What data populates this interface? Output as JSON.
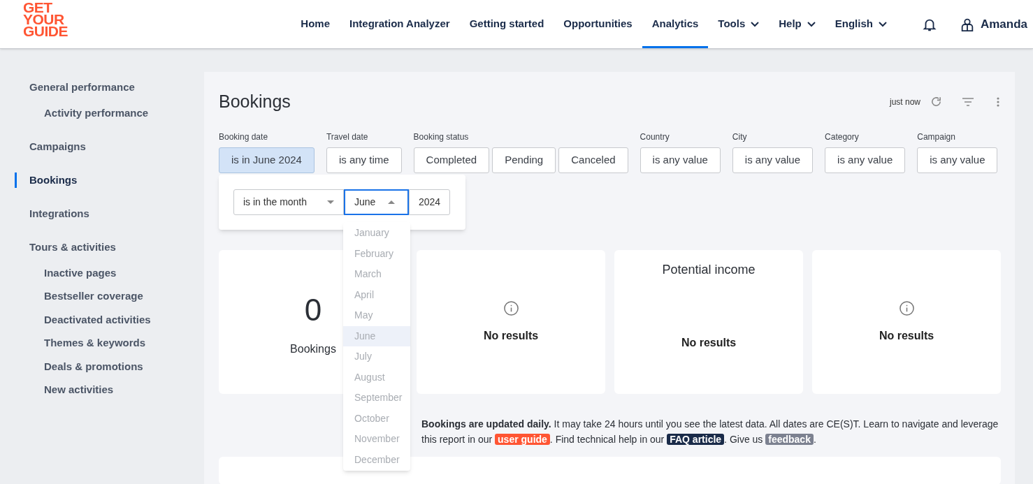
{
  "logo": [
    "GET",
    "YOUR",
    "GUIDE"
  ],
  "nav": [
    {
      "label": "Home",
      "selected": false,
      "dropdown": false
    },
    {
      "label": "Integration Analyzer",
      "selected": false,
      "dropdown": false
    },
    {
      "label": "Getting started",
      "selected": false,
      "dropdown": false
    },
    {
      "label": "Opportunities",
      "selected": false,
      "dropdown": false
    },
    {
      "label": "Analytics",
      "selected": true,
      "dropdown": false
    },
    {
      "label": "Tools",
      "selected": false,
      "dropdown": true
    },
    {
      "label": "Help",
      "selected": false,
      "dropdown": true
    },
    {
      "label": "English",
      "selected": false,
      "dropdown": true
    }
  ],
  "user": {
    "name": "Amanda"
  },
  "sidebar": {
    "items": [
      {
        "label": "General performance",
        "selected": false,
        "children": [
          {
            "label": "Activity performance",
            "selected": false
          }
        ]
      },
      {
        "label": "Campaigns",
        "selected": false
      },
      {
        "label": "Bookings",
        "selected": true
      },
      {
        "label": "Integrations",
        "selected": false
      },
      {
        "label": "Tours & activities",
        "selected": false,
        "children": [
          {
            "label": "Inactive pages",
            "selected": false
          },
          {
            "label": "Bestseller coverage",
            "selected": false
          },
          {
            "label": "Deactivated activities",
            "selected": false
          },
          {
            "label": "Themes & keywords",
            "selected": false
          },
          {
            "label": "Deals & promotions",
            "selected": false
          },
          {
            "label": "New activities",
            "selected": false
          }
        ]
      }
    ]
  },
  "report": {
    "title": "Bookings",
    "updated": "just now",
    "filters": [
      {
        "label": "Booking date",
        "kind": "single",
        "value": "is in June 2024",
        "selected": true
      },
      {
        "label": "Travel date",
        "kind": "single",
        "value": "is any time",
        "selected": false
      },
      {
        "label": "Booking status",
        "kind": "multi",
        "options": [
          "Completed",
          "Pending",
          "Canceled"
        ]
      },
      {
        "label": "Country",
        "kind": "single",
        "value": "is any value",
        "selected": false
      },
      {
        "label": "City",
        "kind": "single",
        "value": "is any value",
        "selected": false
      },
      {
        "label": "Category",
        "kind": "single",
        "value": "is any value",
        "selected": false
      },
      {
        "label": "Campaign",
        "kind": "single",
        "value": "is any value",
        "selected": false
      }
    ],
    "date_popup": {
      "operator": "is in the month",
      "month": "June",
      "year": "2024",
      "months": [
        {
          "label": "January",
          "selected": false
        },
        {
          "label": "February",
          "selected": false
        },
        {
          "label": "March",
          "selected": false
        },
        {
          "label": "April",
          "selected": false
        },
        {
          "label": "May",
          "selected": false
        },
        {
          "label": "June",
          "selected": true
        },
        {
          "label": "July",
          "selected": false
        },
        {
          "label": "August",
          "selected": false
        },
        {
          "label": "September",
          "selected": false
        },
        {
          "label": "October",
          "selected": false
        },
        {
          "label": "November",
          "selected": false
        },
        {
          "label": "December",
          "selected": false
        }
      ]
    },
    "cards": [
      {
        "kind": "metric",
        "value": "0",
        "label": "Bookings"
      },
      {
        "kind": "empty",
        "info_icon": true,
        "message": "No results"
      },
      {
        "kind": "empty",
        "title": "Potential income",
        "message": "No results"
      },
      {
        "kind": "empty",
        "info_icon": true,
        "message": "No results"
      }
    ],
    "note": [
      {
        "kind": "text",
        "text": "**Bookings are updated daily.** It may take 24 hours until you see the latest data. All dates are CE(S)T. Learn to navigate and leverage this report in our "
      },
      {
        "kind": "link",
        "text": "user guide",
        "color": "#ff5533"
      },
      {
        "kind": "text",
        "text": ". Find technical help in our "
      },
      {
        "kind": "link",
        "text": "FAQ article",
        "color": "#1a2b49"
      },
      {
        "kind": "text",
        "text": ". Give us "
      },
      {
        "kind": "link",
        "text": "feedback",
        "color": "#7c8190"
      },
      {
        "kind": "text",
        "text": "."
      }
    ]
  }
}
